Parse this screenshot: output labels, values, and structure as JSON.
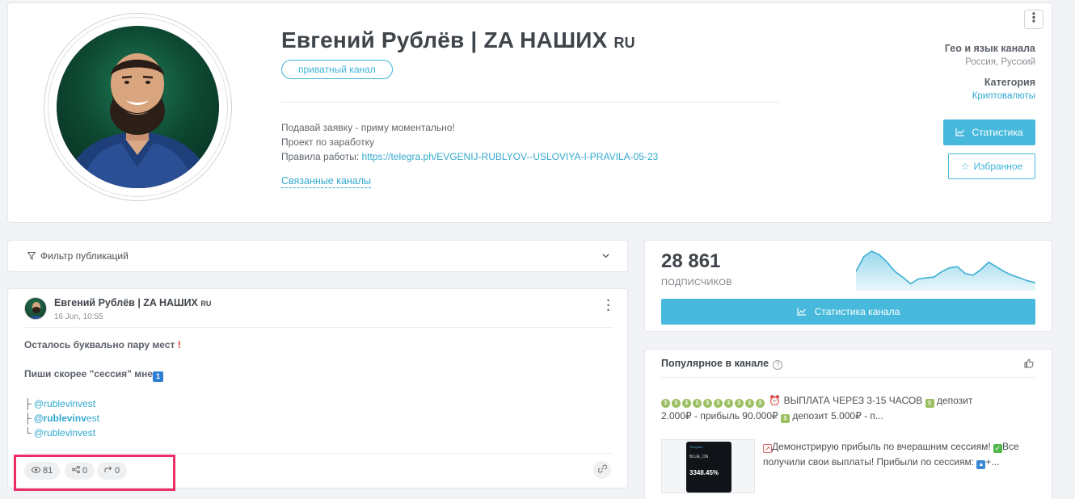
{
  "channel": {
    "title": "Евгений Рублёв | ZA НАШИХ",
    "title_suffix": "RU",
    "badge": "приватный канал",
    "description_lines": [
      "Подавай заявку - приму моментально!",
      "Проект по заработку"
    ],
    "rules_prefix": "Правила работы: ",
    "rules_link": "https://telegra.ph/EVGENIJ-RUBLYOV--USLOVIYA-I-PRAVILA-05-23",
    "related_label": "Связанные каналы",
    "menu_glyph": "⋮"
  },
  "meta": {
    "geo_label": "Гео и язык канала",
    "geo_value": "Россия, Русский",
    "category_label": "Категория",
    "category_value": "Криптовалюты"
  },
  "actions": {
    "stats_label": "Статистика",
    "favorite_label": "Избранное"
  },
  "filter": {
    "label": "Фильтр публикаций"
  },
  "post": {
    "author": "Евгений Рублёв | ZA НАШИХ",
    "author_suffix": "RU",
    "date": "16 Jun, 10:55",
    "line1": "Осталось буквально пару мест",
    "line2": "Пиши скорее \"сессия\" мне",
    "line2_emoji": "1",
    "mentions": [
      {
        "prefix": "├ ",
        "handle": "@rublevinvest",
        "bold_part": "",
        "rest": ""
      },
      {
        "prefix": "├ ",
        "handle": "",
        "bold_part": "@rublevinv",
        "rest": "est"
      },
      {
        "prefix": "└ ",
        "handle": "@rublevinvest",
        "bold_part": "",
        "rest": ""
      }
    ],
    "views": "81",
    "shares": "0",
    "forwards": "0"
  },
  "stats": {
    "subscribers": "28 861",
    "subscribers_label": "ПОДПИСЧИКОВ",
    "button_label": "Статистика канала",
    "sparkline": [
      0.45,
      0.85,
      1.0,
      0.9,
      0.7,
      0.45,
      0.3,
      0.12,
      0.25,
      0.28,
      0.3,
      0.45,
      0.55,
      0.58,
      0.4,
      0.35,
      0.5,
      0.7,
      0.58,
      0.45,
      0.35,
      0.28,
      0.2,
      0.15
    ]
  },
  "popular": {
    "title": "Популярное в канале",
    "item1_text": "ВЫПЛАТА ЧЕРЕЗ 3-15 ЧАСОВ",
    "item1_line1_rest": " депозит",
    "item1_line2": "2.000₽ - прибыль 90.000₽",
    "item1_line2_rest": " депозит 5.000₽ - п...",
    "item2_part1": "Демонстрирую прибыль по вчерашним сессиям!",
    "item2_part2": "Все",
    "item2_part3": "получили свои выплаты! Прибыли по сессиям:",
    "item2_part4": "+...",
    "thumb_header": "Telegram",
    "thumb_balance": "BLUE_ON",
    "thumb_pct": "3348.45%"
  },
  "colors": {
    "accent": "#46b9dc",
    "highlight": "#ec2d66"
  }
}
